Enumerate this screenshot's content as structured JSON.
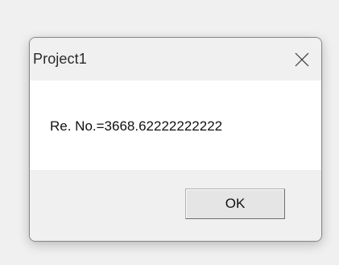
{
  "dialog": {
    "title": "Project1",
    "message": "Re. No.=3668.62222222222",
    "ok_label": "OK",
    "close_icon": "close-icon"
  },
  "colors": {
    "background": "#f0f0f0",
    "content_background": "#ffffff",
    "border": "#8a8a8a",
    "button_face": "#e5e5e5"
  }
}
